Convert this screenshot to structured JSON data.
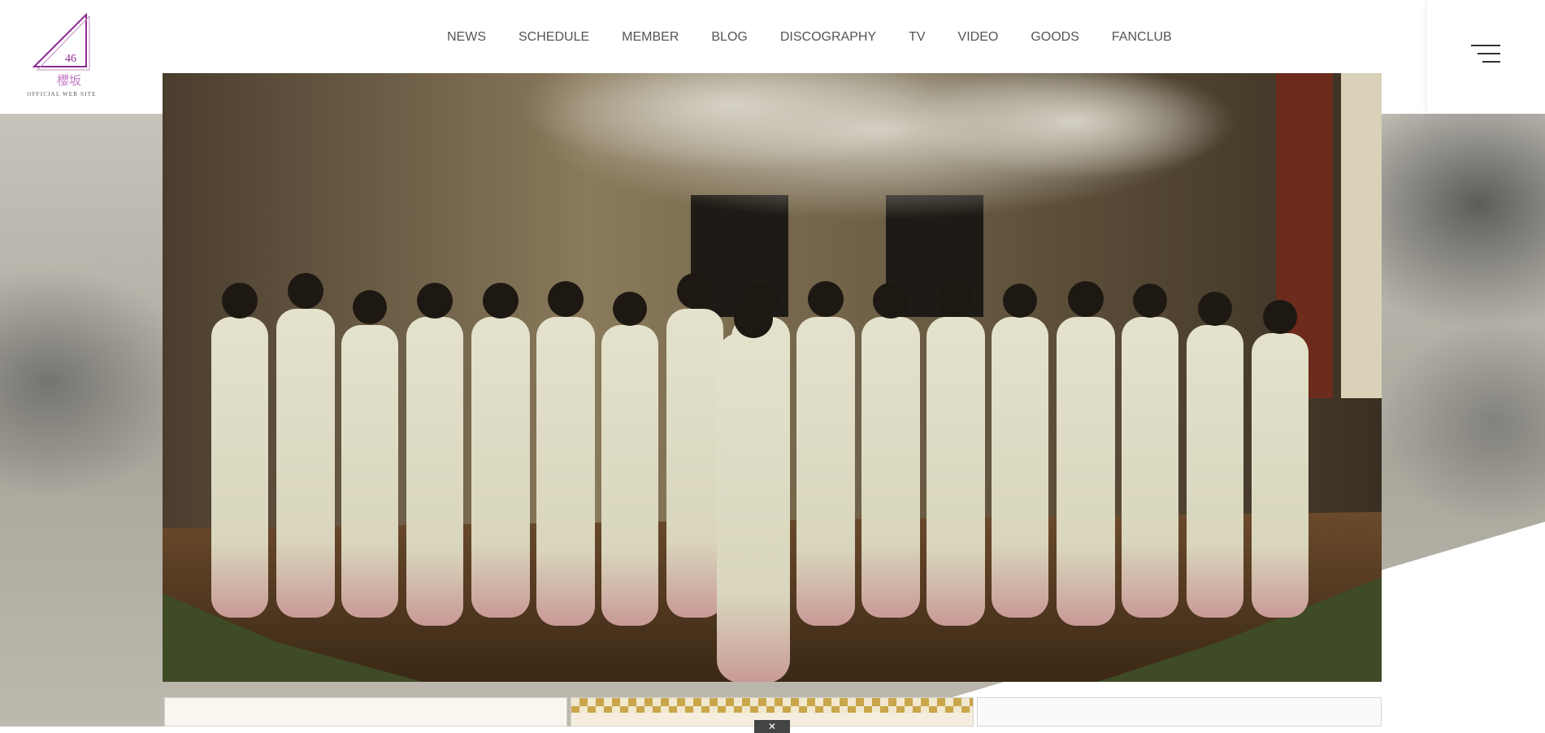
{
  "logo": {
    "number": "46",
    "kanji": "櫻坂",
    "subtitle": "OFFICIAL WEB SITE",
    "accent_color": "#8d2a8f"
  },
  "nav": {
    "items": [
      {
        "label": "NEWS"
      },
      {
        "label": "SCHEDULE"
      },
      {
        "label": "MEMBER"
      },
      {
        "label": "BLOG"
      },
      {
        "label": "DISCOGRAPHY"
      },
      {
        "label": "TV"
      },
      {
        "label": "VIDEO"
      },
      {
        "label": "GOODS"
      },
      {
        "label": "FANCLUB"
      }
    ]
  },
  "menu": {
    "icon": "hamburger-menu-icon"
  },
  "hero": {
    "image": "group-photo"
  },
  "cards": [
    {
      "name": "banner-1"
    },
    {
      "name": "banner-2"
    },
    {
      "name": "banner-3"
    }
  ],
  "close": {
    "label": "✕",
    "icon": "close-icon"
  }
}
